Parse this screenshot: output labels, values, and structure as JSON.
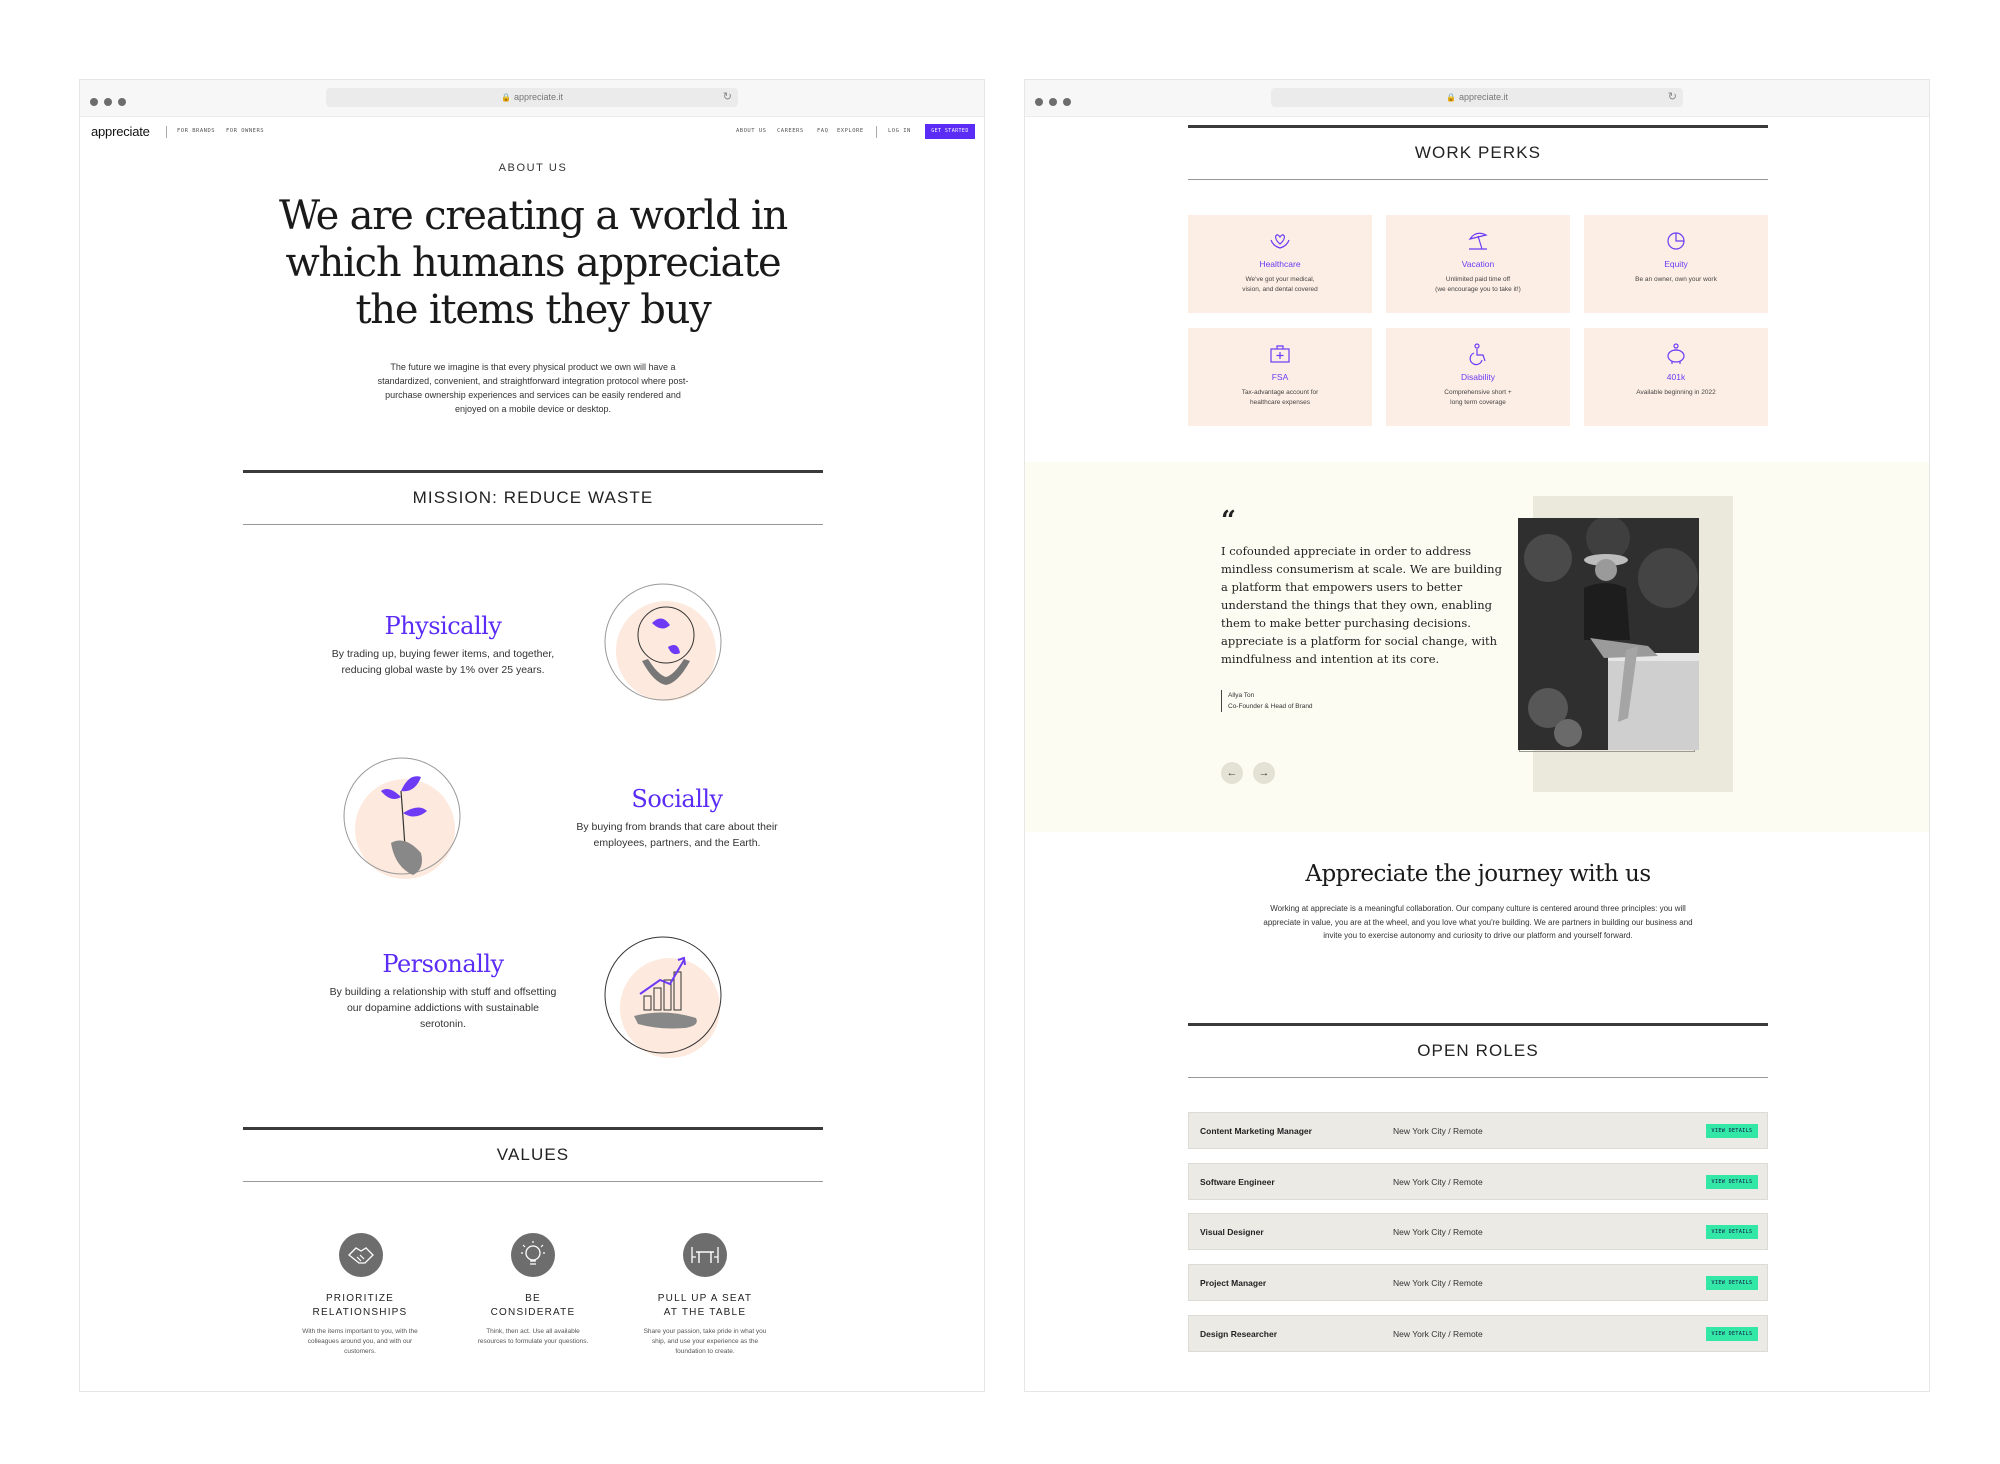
{
  "browser": {
    "url": "appreciate.it"
  },
  "nav": {
    "logo": "appreciate",
    "left_links": [
      "FOR BRANDS",
      "FOR OWNERS"
    ],
    "right_links": [
      "ABOUT US",
      "CAREERS",
      "FAQ",
      "EXPLORE"
    ],
    "login": "LOG IN",
    "cta": "GET STARTED"
  },
  "about": {
    "kicker": "ABOUT US",
    "headline": [
      "We are creating a world in",
      "which humans appreciate",
      "the items they buy"
    ],
    "lead": [
      "The future we imagine is that every physical product we own will have a",
      "standardized, convenient, and straightforward integration protocol where post-",
      "purchase ownership experiences and services can be easily rendered and",
      "enjoyed on a mobile device or desktop."
    ]
  },
  "mission": {
    "title": "MISSION: REDUCE WASTE",
    "items": [
      {
        "title": "Physically",
        "desc": [
          "By trading up, buying fewer items, and together,",
          "reducing global waste by 1% over 25 years."
        ]
      },
      {
        "title": "Socially",
        "desc": [
          "By buying from brands that care about their",
          "employees, partners, and the Earth."
        ]
      },
      {
        "title": "Personally",
        "desc": [
          "By building a relationship with stuff and offsetting",
          "our dopamine addictions with sustainable",
          "serotonin."
        ]
      }
    ]
  },
  "values": {
    "title": "VALUES",
    "items": [
      {
        "icon": "handshake-icon",
        "title": [
          "PRIORITIZE",
          "RELATIONSHIPS"
        ],
        "desc": [
          "With the items important to you, with the",
          "colleagues around you, and with our",
          "customers."
        ]
      },
      {
        "icon": "lightbulb-icon",
        "title": [
          "BE",
          "CONSIDERATE"
        ],
        "desc": [
          "Think, then act. Use all available",
          "resources to formulate your questions."
        ]
      },
      {
        "icon": "table-icon",
        "title": [
          "PULL UP A SEAT",
          "AT THE TABLE"
        ],
        "desc": [
          "Share your passion, take pride in what you",
          "ship, and use your experience as the",
          "foundation to create."
        ]
      }
    ]
  },
  "perks": {
    "title": "WORK PERKS",
    "items": [
      {
        "icon": "heart-hands-icon",
        "title": "Healthcare",
        "desc": [
          "We've got your medical,",
          "vision, and dental covered"
        ]
      },
      {
        "icon": "beach-umbrella-icon",
        "title": "Vacation",
        "desc": [
          "Unlimited paid time off",
          "(we encourage you to take it!)"
        ]
      },
      {
        "icon": "pie-chart-icon",
        "title": "Equity",
        "desc": [
          "Be an owner, own your work"
        ]
      },
      {
        "icon": "medical-kit-icon",
        "title": "FSA",
        "desc": [
          "Tax-advantage account for",
          "healthcare expenses"
        ]
      },
      {
        "icon": "wheelchair-icon",
        "title": "Disability",
        "desc": [
          "Comprehensive short +",
          "long term coverage"
        ]
      },
      {
        "icon": "piggy-bank-icon",
        "title": "401k",
        "desc": [
          "Available beginning in 2022"
        ]
      }
    ]
  },
  "testimonial": {
    "quote_mark": "“",
    "quote": [
      "I cofounded appreciate in order to address",
      "mindless consumerism at scale. We are building",
      "a platform that empowers users to better",
      "understand the things that they own, enabling",
      "them to make better purchasing decisions.",
      "appreciate is a platform for social change, with",
      "mindfulness and intention at its core."
    ],
    "name": "Allya Ton",
    "role": "Co-Founder & Head of Brand",
    "prev": "←",
    "next": "→"
  },
  "journey": {
    "title": "Appreciate the journey with us",
    "body": [
      "Working at appreciate is a meaningful collaboration. Our company culture is centered around three principles: you will",
      "appreciate in value, you are at the wheel, and you love what you're building. We are partners in building our business and",
      "invite you to exercise autonomy and curiosity to drive our platform and yourself forward."
    ]
  },
  "roles": {
    "title": "OPEN ROLES",
    "button": "VIEW DETAILS",
    "items": [
      {
        "name": "Content Marketing Manager",
        "location": "New York City / Remote"
      },
      {
        "name": "Software Engineer",
        "location": "New York City / Remote"
      },
      {
        "name": "Visual Designer",
        "location": "New York City / Remote"
      },
      {
        "name": "Project Manager",
        "location": "New York City / Remote"
      },
      {
        "name": "Design Researcher",
        "location": "New York City / Remote"
      }
    ]
  },
  "colors": {
    "accent": "#5b2cf5",
    "perk_bg": "#fdeee5",
    "quote_bg": "#fcfcf2",
    "badge": "#33e8a6"
  }
}
